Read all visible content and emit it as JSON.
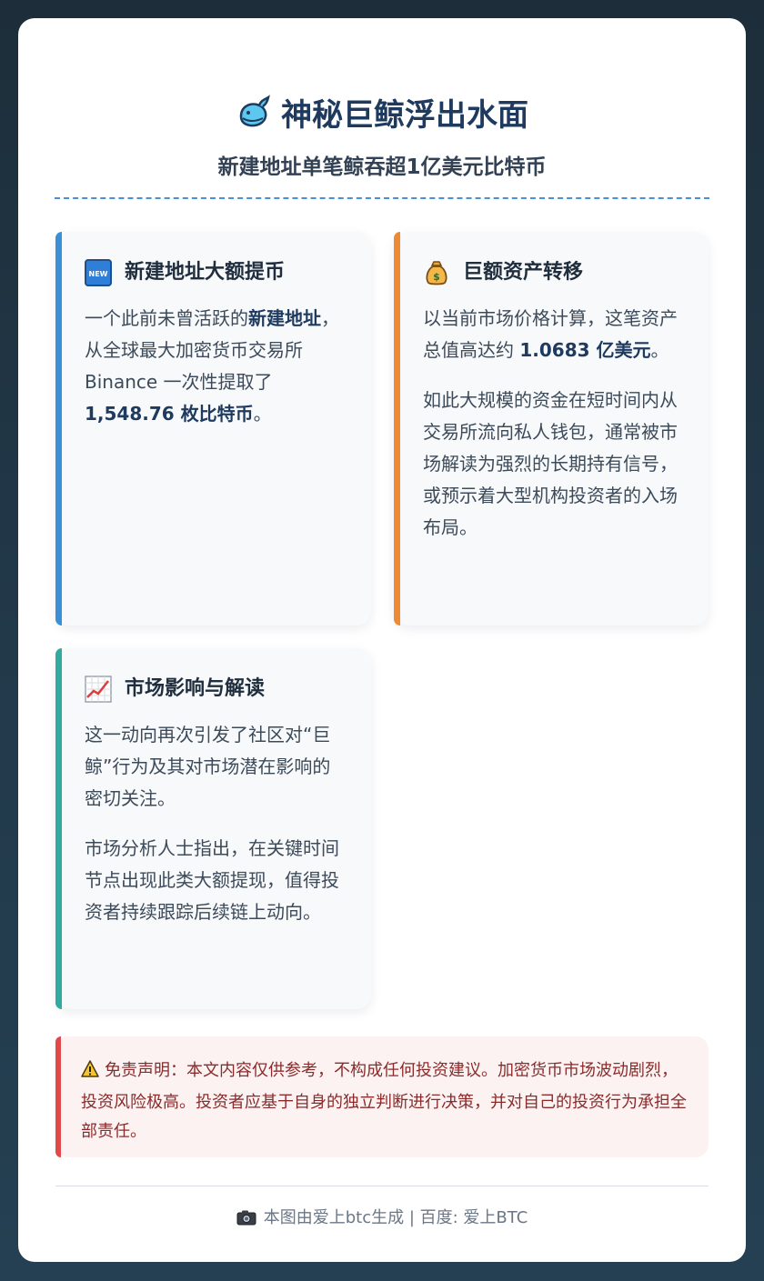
{
  "header": {
    "title": "神秘巨鲸浮出水面",
    "subtitle": "新建地址单笔鲸吞超1亿美元比特币",
    "title_icon": "whale-icon"
  },
  "cards": [
    {
      "title": "新建地址大额提币",
      "icon": "new-badge-icon",
      "accent": "#3b8fd6",
      "paragraphs": [
        {
          "parts": [
            {
              "text": "一个此前未曾活跃的"
            },
            {
              "text": "新建地址",
              "bold": true
            },
            {
              "text": "，从全球最大加密货币交易所 Binance 一次性提取了 "
            },
            {
              "text": "1,548.76 枚比特币",
              "bold": true
            },
            {
              "text": "。"
            }
          ]
        }
      ]
    },
    {
      "title": "巨额资产转移",
      "icon": "money-bag-icon",
      "accent": "#ee8a34",
      "paragraphs": [
        {
          "parts": [
            {
              "text": "以当前市场价格计算，这笔资产总值高达约 "
            },
            {
              "text": "1.0683 亿美元",
              "bold": true
            },
            {
              "text": "。"
            }
          ]
        },
        {
          "parts": [
            {
              "text": "如此大规模的资金在短时间内从交易所流向私人钱包，通常被市场解读为强烈的长期持有信号，或预示着大型机构投资者的入场布局。"
            }
          ]
        }
      ]
    },
    {
      "title": "市场影响与解读",
      "icon": "chart-increasing-icon",
      "accent": "#33aaa0",
      "paragraphs": [
        {
          "parts": [
            {
              "text": "这一动向再次引发了社区对“巨鲸”行为及其对市场潜在影响的密切关注。"
            }
          ]
        },
        {
          "parts": [
            {
              "text": "市场分析人士指出，在关键时间节点出现此类大额提现，值得投资者持续跟踪后续链上动向。"
            }
          ]
        }
      ]
    }
  ],
  "disclaimer": {
    "icon": "warning-icon",
    "text": "免责声明：本文内容仅供参考，不构成任何投资建议。加密货币市场波动剧烈，投资风险极高。投资者应基于自身的独立判断进行决策，并对自己的投资行为承担全部责任。"
  },
  "footer": {
    "icon": "camera-icon",
    "text": "本图由爱上btc生成 | 百度: 爱上BTC"
  },
  "colors": {
    "title": "#1e3a5f",
    "divider": "#4a90d9",
    "disclaimer_accent": "#e0484a"
  }
}
